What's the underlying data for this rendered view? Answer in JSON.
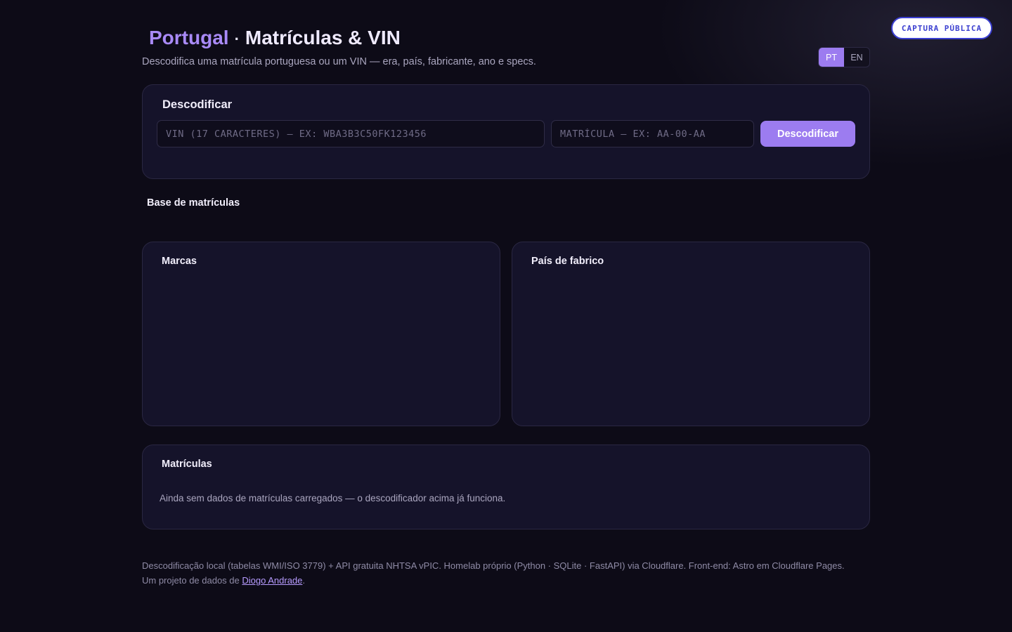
{
  "badge": {
    "label": "CAPTURA PÚBLICA"
  },
  "header": {
    "country": "Portugal",
    "separator": "·",
    "title": "Matrículas & VIN",
    "subtitle": "Descodifica uma matrícula portuguesa ou um VIN — era, país, fabricante, ano e specs."
  },
  "lang": {
    "options": [
      "PT",
      "EN"
    ],
    "selected": "PT"
  },
  "decoder": {
    "title": "Descodificar",
    "vin_placeholder": "VIN (17 CARACTERES) — EX: WBA3B3C50FK123456",
    "plate_placeholder": "MATRÍCULA — EX: AA-00-AA",
    "button_label": "Descodificar"
  },
  "database": {
    "section_label": "Base de matrículas",
    "brands_title": "Marcas",
    "country_title": "País de fabrico",
    "plates_title": "Matrículas",
    "empty_message": "Ainda sem dados de matrículas carregados — o descodificador acima já funciona."
  },
  "footer": {
    "line1": "Descodificação local (tabelas WMI/ISO 3779) + API gratuita NHTSA vPIC. Homelab próprio (Python · SQLite · FastAPI) via Cloudflare. Front-end: Astro em Cloudflare Pages.",
    "line2_prefix": "Um projeto de dados de ",
    "author": "Diogo Andrade",
    "line2_suffix": "."
  },
  "colors": {
    "accent": "#9c7cf0",
    "background": "#0d0b17",
    "card": "#15132a"
  }
}
